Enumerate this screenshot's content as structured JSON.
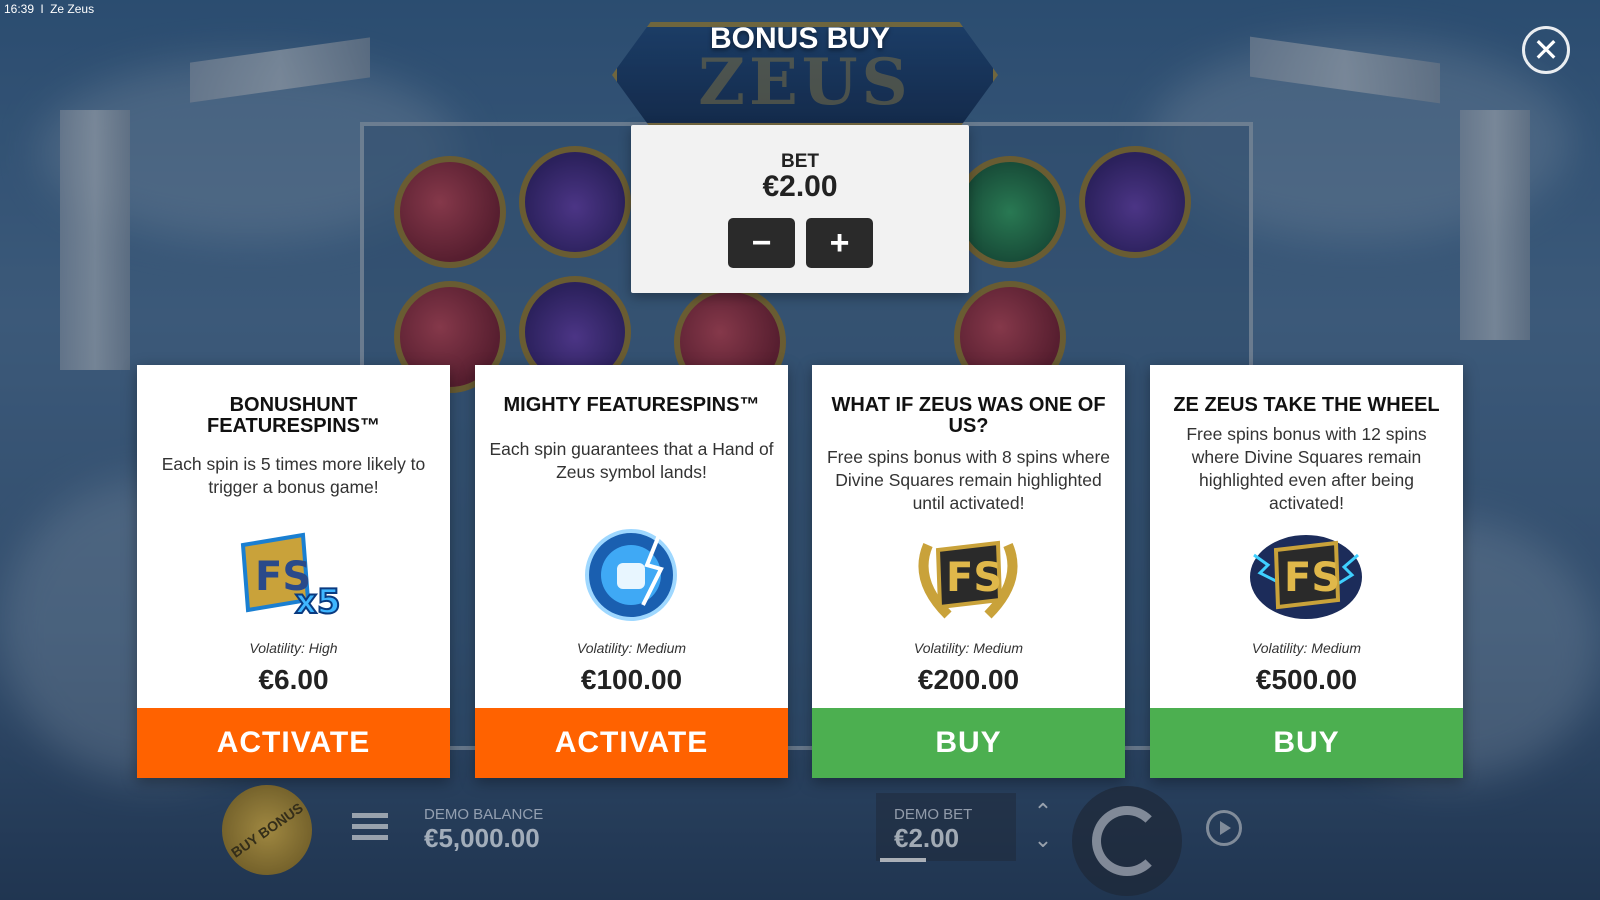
{
  "status_bar": {
    "time": "16:39",
    "app_title": "Ze Zeus"
  },
  "game": {
    "logo_text": "ZEUS",
    "logo_small": "ZE"
  },
  "dialog": {
    "title": "BONUS BUY",
    "close_icon": "close-icon"
  },
  "bet": {
    "label": "BET",
    "value": "€2.00",
    "minus": "−",
    "plus": "+"
  },
  "cards": [
    {
      "title": "BONUSHUNT FEATURESPINS™",
      "description": "Each spin is 5 times more likely to trigger a bonus game!",
      "icon": "fs-x5-icon",
      "volatility": "Volatility: High",
      "price": "€6.00",
      "button": "ACTIVATE",
      "button_color": "#ff6200"
    },
    {
      "title": "MIGHTY FEATURESPINS™",
      "description": "Each spin guarantees that a Hand of Zeus symbol lands!",
      "icon": "hand-of-zeus-icon",
      "volatility": "Volatility: Medium",
      "price": "€100.00",
      "button": "ACTIVATE",
      "button_color": "#ff6200"
    },
    {
      "title": "WHAT IF ZEUS WAS ONE OF US?",
      "description": "Free spins bonus with 8 spins where Divine Squares remain highlighted until activated!",
      "icon": "fs-laurel-icon",
      "volatility": "Volatility: Medium",
      "price": "€200.00",
      "button": "BUY",
      "button_color": "#4caf50"
    },
    {
      "title": "ZE ZEUS TAKE THE WHEEL",
      "description": "Free spins bonus with 12 spins where Divine Squares remain highlighted even after being activated!",
      "icon": "fs-storm-icon",
      "volatility": "Volatility: Medium",
      "price": "€500.00",
      "button": "BUY",
      "button_color": "#4caf50"
    }
  ],
  "bottom_bar": {
    "buy_bonus": "BUY BONUS",
    "balance_label": "DEMO BALANCE",
    "balance_value": "€5,000.00",
    "bet_label": "DEMO BET",
    "bet_value": "€2.00",
    "arrow_up": "⌃",
    "arrow_down": "⌄"
  }
}
